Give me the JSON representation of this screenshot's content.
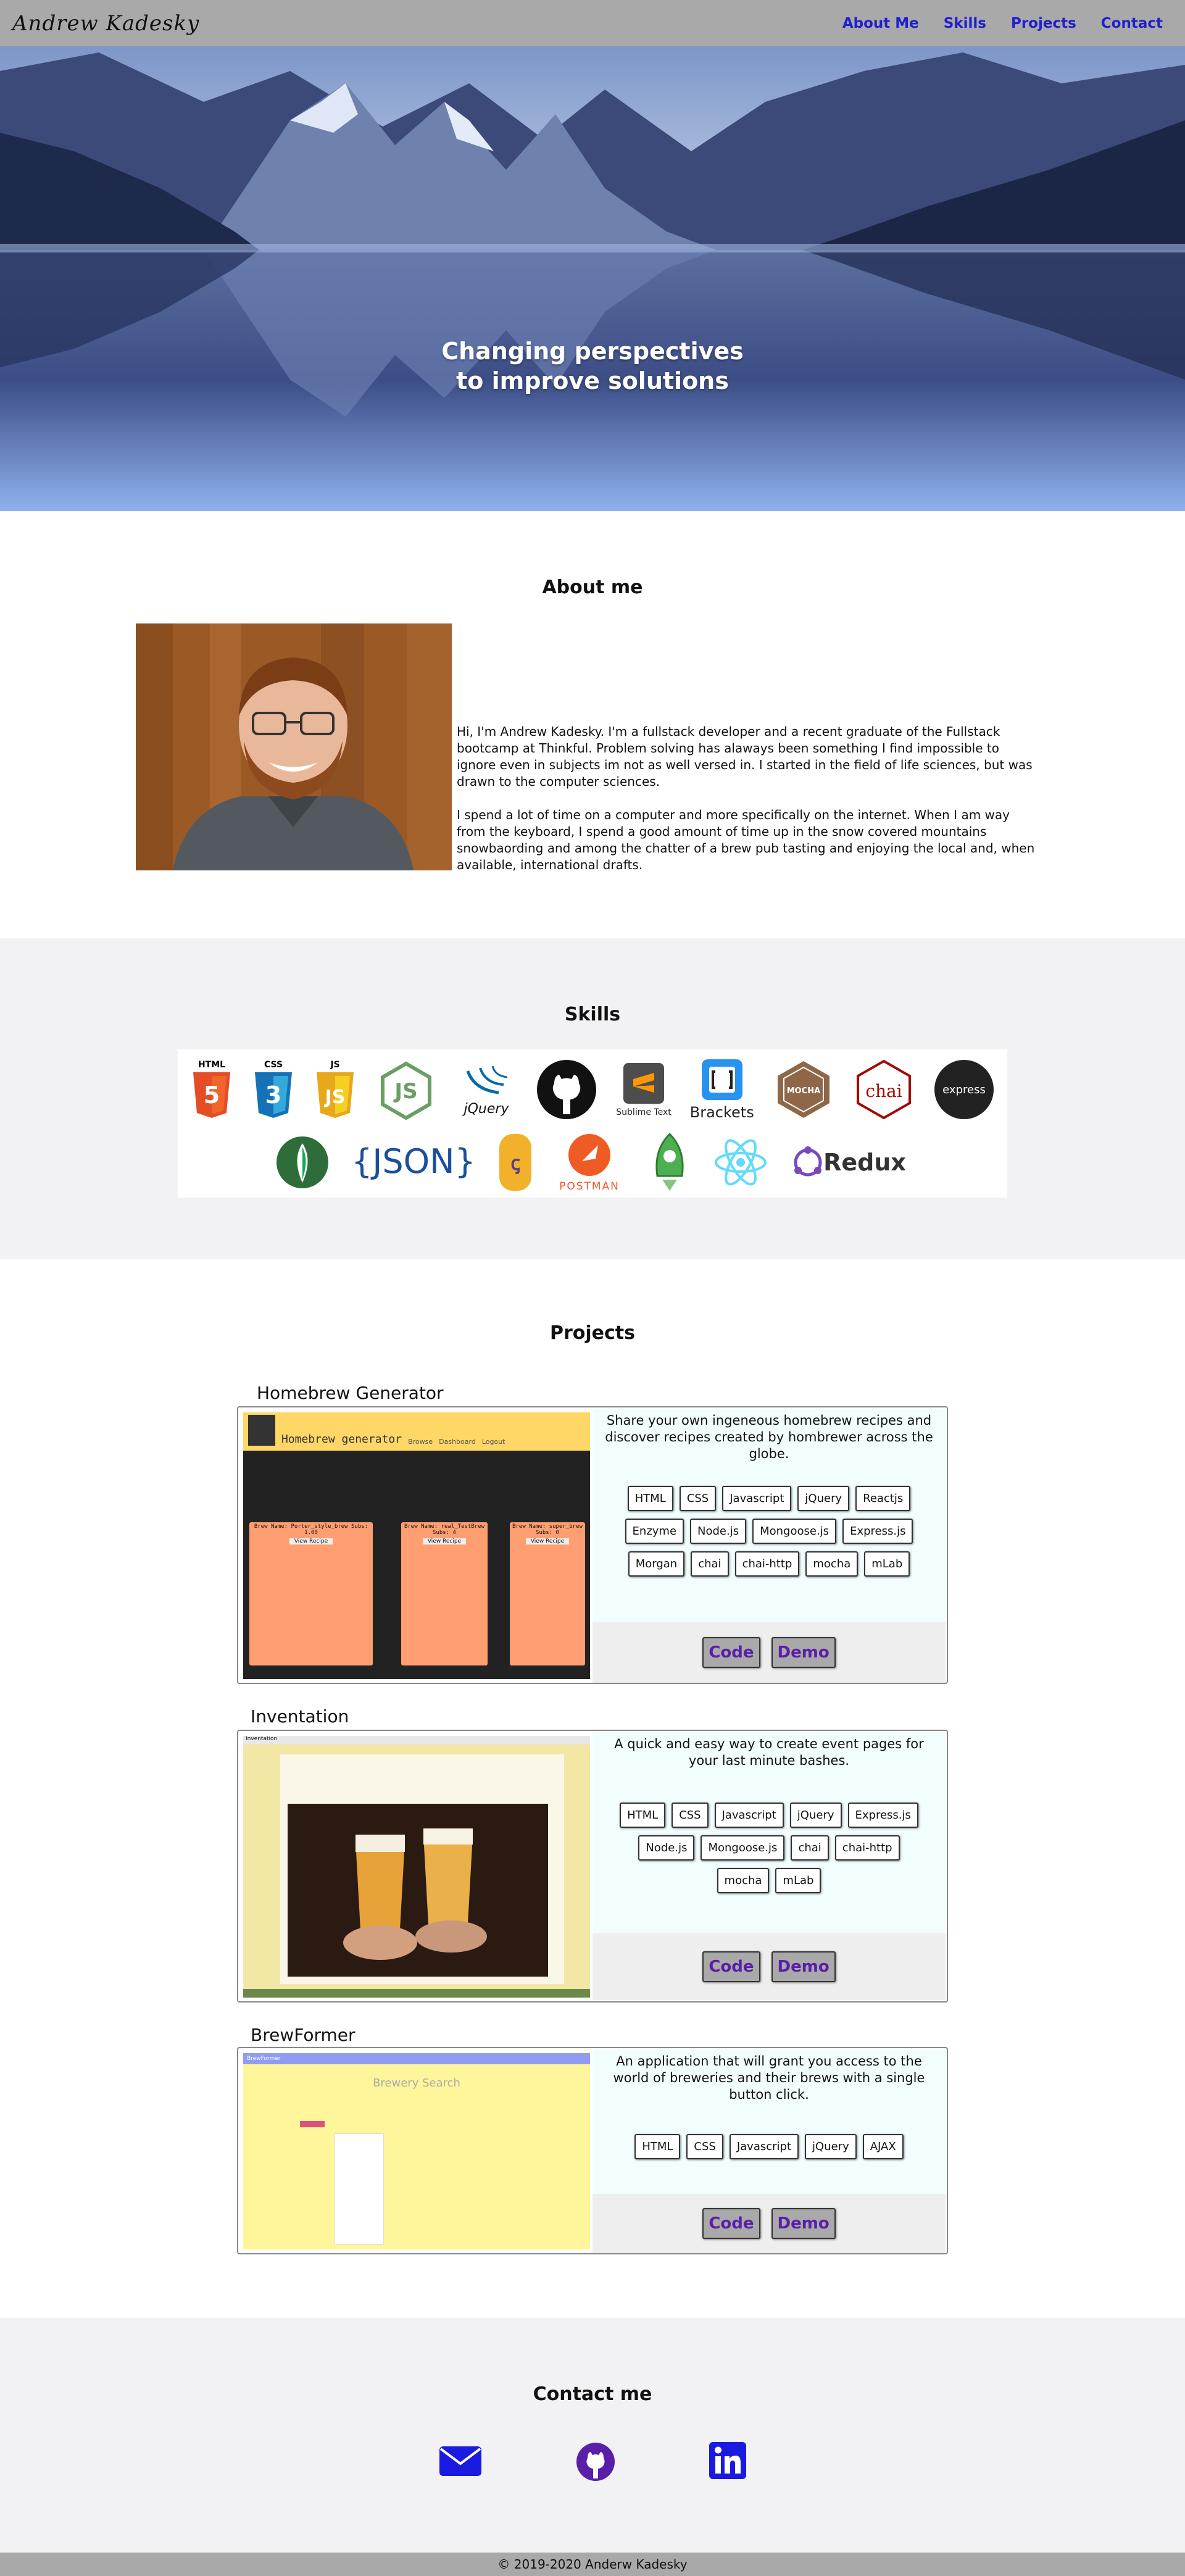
{
  "nav": {
    "brand": "Andrew Kadesky",
    "links": [
      "About Me",
      "Skills",
      "Projects",
      "Contact"
    ]
  },
  "hero": {
    "line1": "Changing perspectives",
    "line2": "to improve solutions"
  },
  "about": {
    "title": "About me",
    "p1": "Hi, I'm Andrew Kadesky. I'm a fullstack developer and a recent graduate of the Fullstack bootcamp at Thinkful. Problem solving has alaways been something I find impossible to ignore even in subjects im not as well versed in. I started in the field of life sciences, but was drawn to the computer sciences.",
    "p2": "I spend a lot of time on a computer and more specifically on the internet. When I am way from the keyboard, I spend a good amount of time up in the snow covered mountains snowbaording and among the chatter of a brew pub tasting and enjoying the local and, when available, international drafts."
  },
  "skills": {
    "title": "Skills",
    "html_label": "HTML",
    "css_label": "CSS",
    "js_label": "JS",
    "jquery_label": "jQuery",
    "sublime_label": "Sublime Text",
    "brackets_label": "Brackets",
    "mocha_label": "MOCHA",
    "chai_label": "chai",
    "express_label": "express",
    "json_label": "{JSON}",
    "postman_label": "POSTMAN",
    "redux_label": "Redux"
  },
  "projects": {
    "title": "Projects",
    "items": [
      {
        "name": "Homebrew Generator",
        "description": "Share your own ingeneous homebrew recipes and discover recipes created by hombrewer across the globe.",
        "tags": [
          "HTML",
          "CSS",
          "Javascript",
          "jQuery",
          "Reactjs",
          "Enzyme",
          "Node.js",
          "Mongoose.js",
          "Express.js",
          "Morgan",
          "chai",
          "chai-http",
          "mocha",
          "mLab"
        ],
        "code": "Code",
        "demo": "Demo",
        "shot": {
          "title": "Homebrew generator",
          "nav": [
            "Browse",
            "Dashboard",
            "Logout"
          ],
          "cards": [
            "Brew Name: Porter_style_brew Subs: 1.00",
            "Brew Name: real_TestBrew Subs: 4",
            "Brew Name: super_brew Subs: 0"
          ],
          "view": "View Recipe"
        }
      },
      {
        "name": "Inventation",
        "description": "A quick and easy way to create event pages for your last minute bashes.",
        "tags": [
          "HTML",
          "CSS",
          "Javascript",
          "jQuery",
          "Express.js",
          "Node.js",
          "Mongoose.js",
          "chai",
          "chai-http",
          "mocha",
          "mLab"
        ],
        "code": "Code",
        "demo": "Demo",
        "shot": {
          "title": "Inventation"
        }
      },
      {
        "name": "BrewFormer",
        "description": "An application that will grant you access to the world of breweries and their brews with a single button click.",
        "tags": [
          "HTML",
          "CSS",
          "Javascript",
          "jQuery",
          "AJAX"
        ],
        "code": "Code",
        "demo": "Demo",
        "shot": {
          "title": "BrewFormer",
          "heading": "Brewery Search"
        }
      }
    ]
  },
  "contact": {
    "title": "Contact me",
    "icons": [
      "envelope-icon",
      "github-icon",
      "linkedin-icon"
    ]
  },
  "footer": {
    "text": "© 2019-2020 Anderw Kadesky"
  },
  "colors": {
    "nav_bg": "#a9a9a9",
    "link": "#1f1fd0",
    "card_info_bg": "#f2fefe",
    "button_text": "#5a1ea8",
    "section_gray": "#f2f2f4"
  }
}
